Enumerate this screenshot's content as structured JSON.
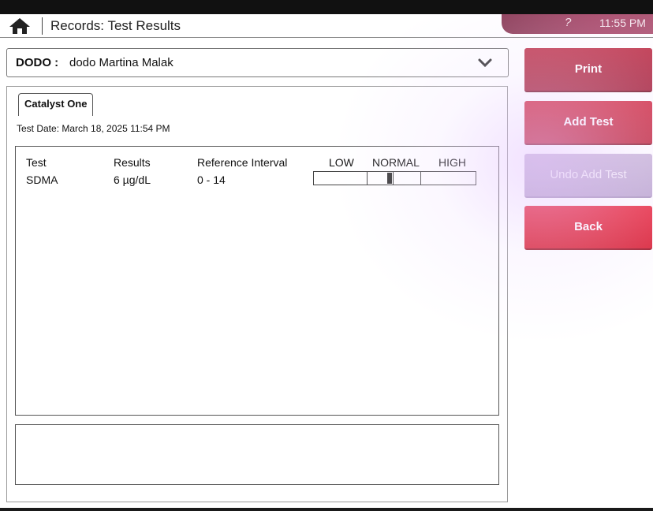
{
  "header": {
    "title": "Records: Test Results",
    "help": "?",
    "time": "11:55 PM",
    "home_icon": "home-icon"
  },
  "patient": {
    "id": "DODO :",
    "name": "dodo Martina Malak",
    "dropdown_icon": "chevron-down-icon"
  },
  "tabs": [
    {
      "label": "Catalyst One",
      "active": true
    }
  ],
  "test_date": "Test Date: March 18, 2025 11:54 PM",
  "results": {
    "columns": {
      "test": "Test",
      "results": "Results",
      "reference": "Reference Interval",
      "low": "LOW",
      "normal": "NORMAL",
      "high": "HIGH"
    },
    "rows": [
      {
        "test": "SDMA",
        "result": "6 µg/dL",
        "reference": "0 - 14",
        "value": 6,
        "ref_low": 0,
        "ref_high": 14
      }
    ]
  },
  "notes": "",
  "buttons": {
    "print": "Print",
    "add_test": "Add Test",
    "undo_add_test": "Undo Add Test",
    "back": "Back"
  },
  "colors": {
    "primary_button": "#c0283e",
    "back_button": "#d81d31",
    "disabled_button": "#bba6cf",
    "status_bar": "#8a3a55"
  }
}
